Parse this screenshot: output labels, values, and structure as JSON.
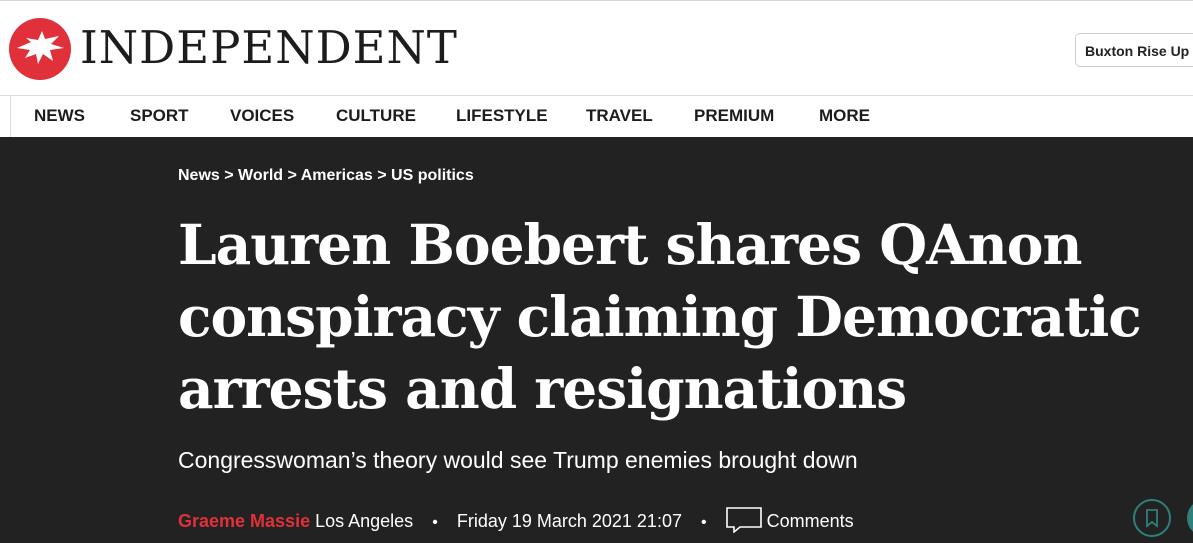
{
  "brand": {
    "name": "INDEPENDENT",
    "logo": "eagle-logo-icon",
    "accent": "#e0313a"
  },
  "header": {
    "account_label": "Buxton Rise Up"
  },
  "nav": {
    "items": [
      "NEWS",
      "SPORT",
      "VOICES",
      "CULTURE",
      "LIFESTYLE",
      "TRAVEL",
      "PREMIUM",
      "MORE"
    ]
  },
  "breadcrumb": [
    "News",
    "World",
    "Americas",
    "US politics"
  ],
  "breadcrumb_sep": ">",
  "article": {
    "headline_lines": [
      "Lauren Boebert shares QAnon",
      "conspiracy claiming Democratic",
      "arrests and resignations"
    ],
    "standfirst": "Congresswoman’s theory would see Trump enemies brought down",
    "author": "Graeme Massie",
    "location": "Los Angeles",
    "date": "Friday 19 March 2021 21:07",
    "comments_label": "Comments",
    "bullet": "•"
  },
  "colors": {
    "article_bg": "#222222",
    "teal": "#2f7f7a"
  }
}
